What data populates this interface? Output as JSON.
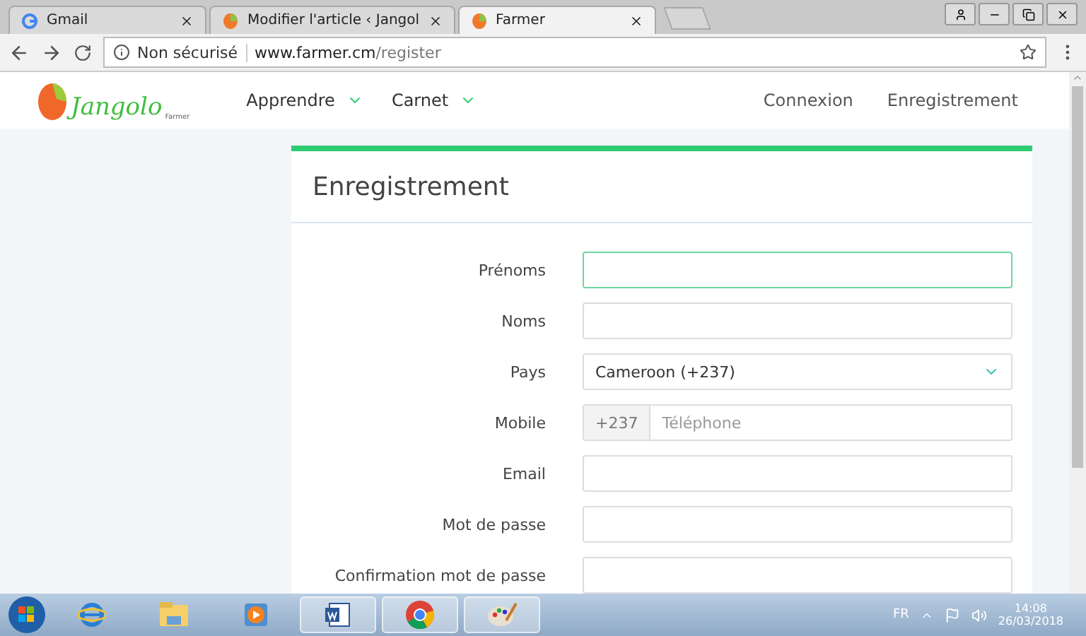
{
  "browser": {
    "tabs": [
      {
        "title": "Gmail",
        "kind": "google",
        "selected": false
      },
      {
        "title": "Modifier l'article ‹ Jangol",
        "kind": "mango",
        "selected": false
      },
      {
        "title": "Farmer",
        "kind": "mango",
        "selected": true
      }
    ],
    "security": "Non sécurisé",
    "url_host": "www.farmer.cm",
    "url_path": "/register"
  },
  "site": {
    "logo_text": "Jangolo",
    "logo_subtext": "Farmer",
    "nav": [
      {
        "label": "Apprendre",
        "dropdown": true
      },
      {
        "label": "Carnet",
        "dropdown": true
      }
    ],
    "nav_right": [
      {
        "label": "Connexion"
      },
      {
        "label": "Enregistrement"
      }
    ]
  },
  "form": {
    "title": "Enregistrement",
    "fields": [
      {
        "label": "Prénoms",
        "kind": "text",
        "focused": true
      },
      {
        "label": "Noms",
        "kind": "text",
        "focused": false
      },
      {
        "label": "Pays",
        "kind": "select",
        "value": "Cameroon (+237)",
        "focused": false
      },
      {
        "label": "Mobile",
        "kind": "phone",
        "prefix": "+237",
        "placeholder": "Téléphone",
        "focused": false
      },
      {
        "label": "Email",
        "kind": "text",
        "focused": false
      },
      {
        "label": "Mot de passe",
        "kind": "text",
        "focused": false
      },
      {
        "label": "Confirmation mot de passe",
        "kind": "text",
        "focused": false
      }
    ]
  },
  "taskbar": {
    "apps": [
      {
        "kind": "ie",
        "running": false
      },
      {
        "kind": "folder",
        "running": false
      },
      {
        "kind": "media",
        "running": false
      },
      {
        "kind": "word",
        "running": true
      },
      {
        "kind": "chrome",
        "running": true
      },
      {
        "kind": "paint",
        "running": true
      }
    ],
    "language": "FR",
    "time": "14:08",
    "date": "26/03/2018"
  }
}
